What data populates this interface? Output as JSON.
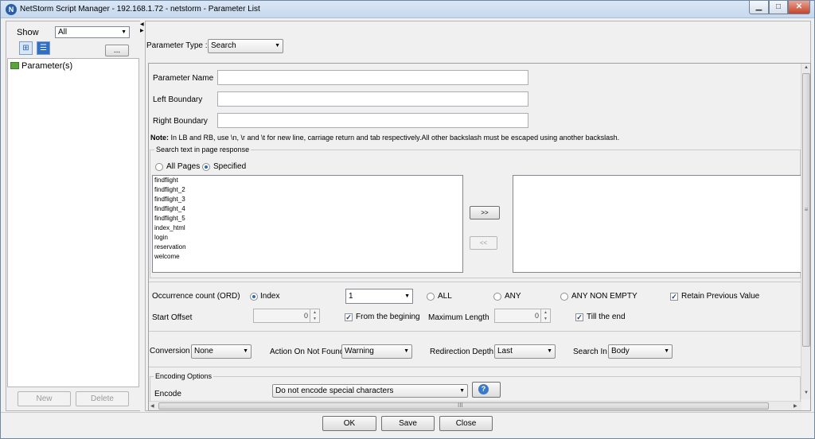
{
  "window": {
    "title": "NetStorm  Script Manager - 192.168.1.72 - netstorm - Parameter List",
    "min_glyph": "▁",
    "max_glyph": "□",
    "close_glyph": "✕"
  },
  "left_panel": {
    "show_label": "Show",
    "show_value": "All",
    "more_button": "...",
    "tree_root": "Parameter(s)",
    "new_button": "New",
    "delete_button": "Delete"
  },
  "parameter_type": {
    "label": "Parameter Type :",
    "value": "Search"
  },
  "fields": {
    "parameter_name_label": "Parameter Name",
    "parameter_name_value": "",
    "left_boundary_label": "Left Boundary",
    "left_boundary_value": "",
    "right_boundary_label": "Right Boundary",
    "right_boundary_value": "",
    "note_bold": "Note:",
    "note_text": " In LB and RB, use \\n, \\r and \\t for new line, carriage return and tab respectively.All other backslash must be escaped using another backslash."
  },
  "search_group": {
    "legend": "Search text in page response",
    "all_pages_label": "All Pages",
    "all_pages_selected": false,
    "specified_label": "Specified",
    "specified_selected": true,
    "pages": [
      "findflight",
      "findflight_2",
      "findflight_3",
      "findflight_4",
      "findflight_5",
      "index_html",
      "login",
      "reservation",
      "welcome"
    ],
    "selected_pages": [],
    "add_button": ">>",
    "remove_button": "<<"
  },
  "occurrence": {
    "label": "Occurrence count (ORD)",
    "index_label": "Index",
    "index_selected": true,
    "index_value": "1",
    "all_label": "ALL",
    "any_label": "ANY",
    "any_non_empty_label": "ANY NON EMPTY",
    "retain_label": "Retain Previous Value",
    "retain_checked": true,
    "start_offset_label": "Start Offset",
    "start_offset_value": "0",
    "from_beginning_label": "From the begining",
    "from_beginning_checked": true,
    "max_length_label": "Maximum Length",
    "max_length_value": "0",
    "till_end_label": "Till the end",
    "till_end_checked": true
  },
  "options": {
    "conversion_label": "Conversion",
    "conversion_value": "None",
    "action_label": "Action On Not Found",
    "action_value": "Warning",
    "redirection_label": "Redirection Depth",
    "redirection_value": "Last",
    "search_in_label": "Search In",
    "search_in_value": "Body"
  },
  "encoding": {
    "legend": "Encoding Options",
    "encode_label": "Encode",
    "encode_value": "Do not encode special characters",
    "help_glyph": "?"
  },
  "footer": {
    "ok_button": "OK",
    "save_button": "Save",
    "close_button": "Close"
  },
  "icons": {
    "combo_arrow": "▼",
    "check_mark": "✓",
    "grip_vertical": "≡",
    "grip_horizontal": "III"
  }
}
